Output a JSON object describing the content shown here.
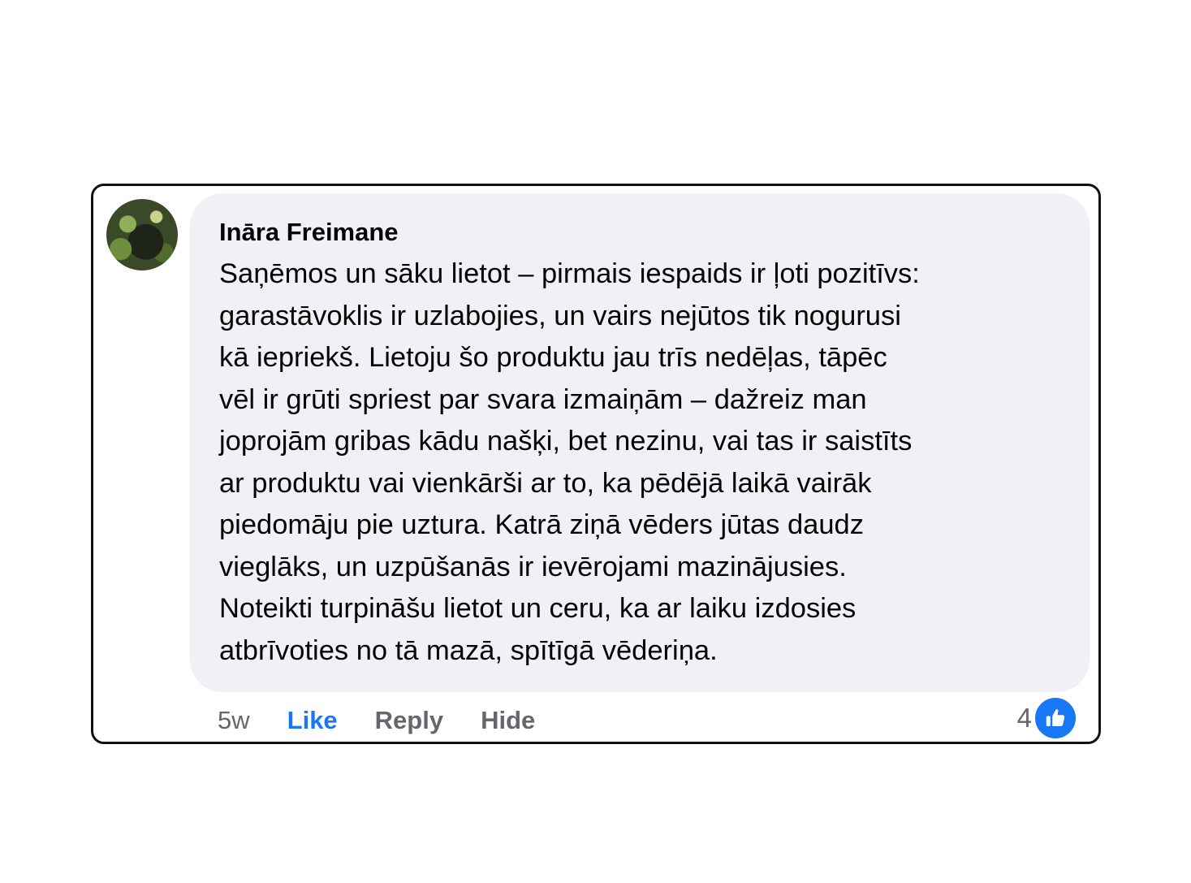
{
  "comment": {
    "author": "Ināra Freimane",
    "avatar_icon": "profile-photo",
    "lines": [
      "Saņēmos un sāku lietot – pirmais iespaids ir ļoti pozitīvs:",
      "garastāvoklis ir uzlabojies, un vairs nejūtos tik nogurusi",
      "kā iepriekš. Lietoju šo produktu jau trīs nedēļas, tāpēc",
      "vēl ir grūti spriest par svara izmaiņām – dažreiz man",
      "joprojām gribas kādu našķi, bet nezinu, vai tas ir saistīts",
      "ar produktu vai vienkārši ar to, ka pēdējā laikā vairāk",
      "piedomāju pie uztura. Katrā ziņā vēders jūtas daudz",
      "vieglāks, un uzpūšanās ir ievērojami mazinājusies.",
      "Noteikti turpināšu lietot un ceru, ka ar laiku izdosies",
      "atbrīvoties no tā mazā, spītīgā vēderiņa."
    ]
  },
  "actions": {
    "timestamp": "5w",
    "like_label": "Like",
    "reply_label": "Reply",
    "hide_label": "Hide"
  },
  "reactions": {
    "count": "4",
    "icon": "thumbs-up-icon",
    "accent_color": "#1877f2"
  }
}
